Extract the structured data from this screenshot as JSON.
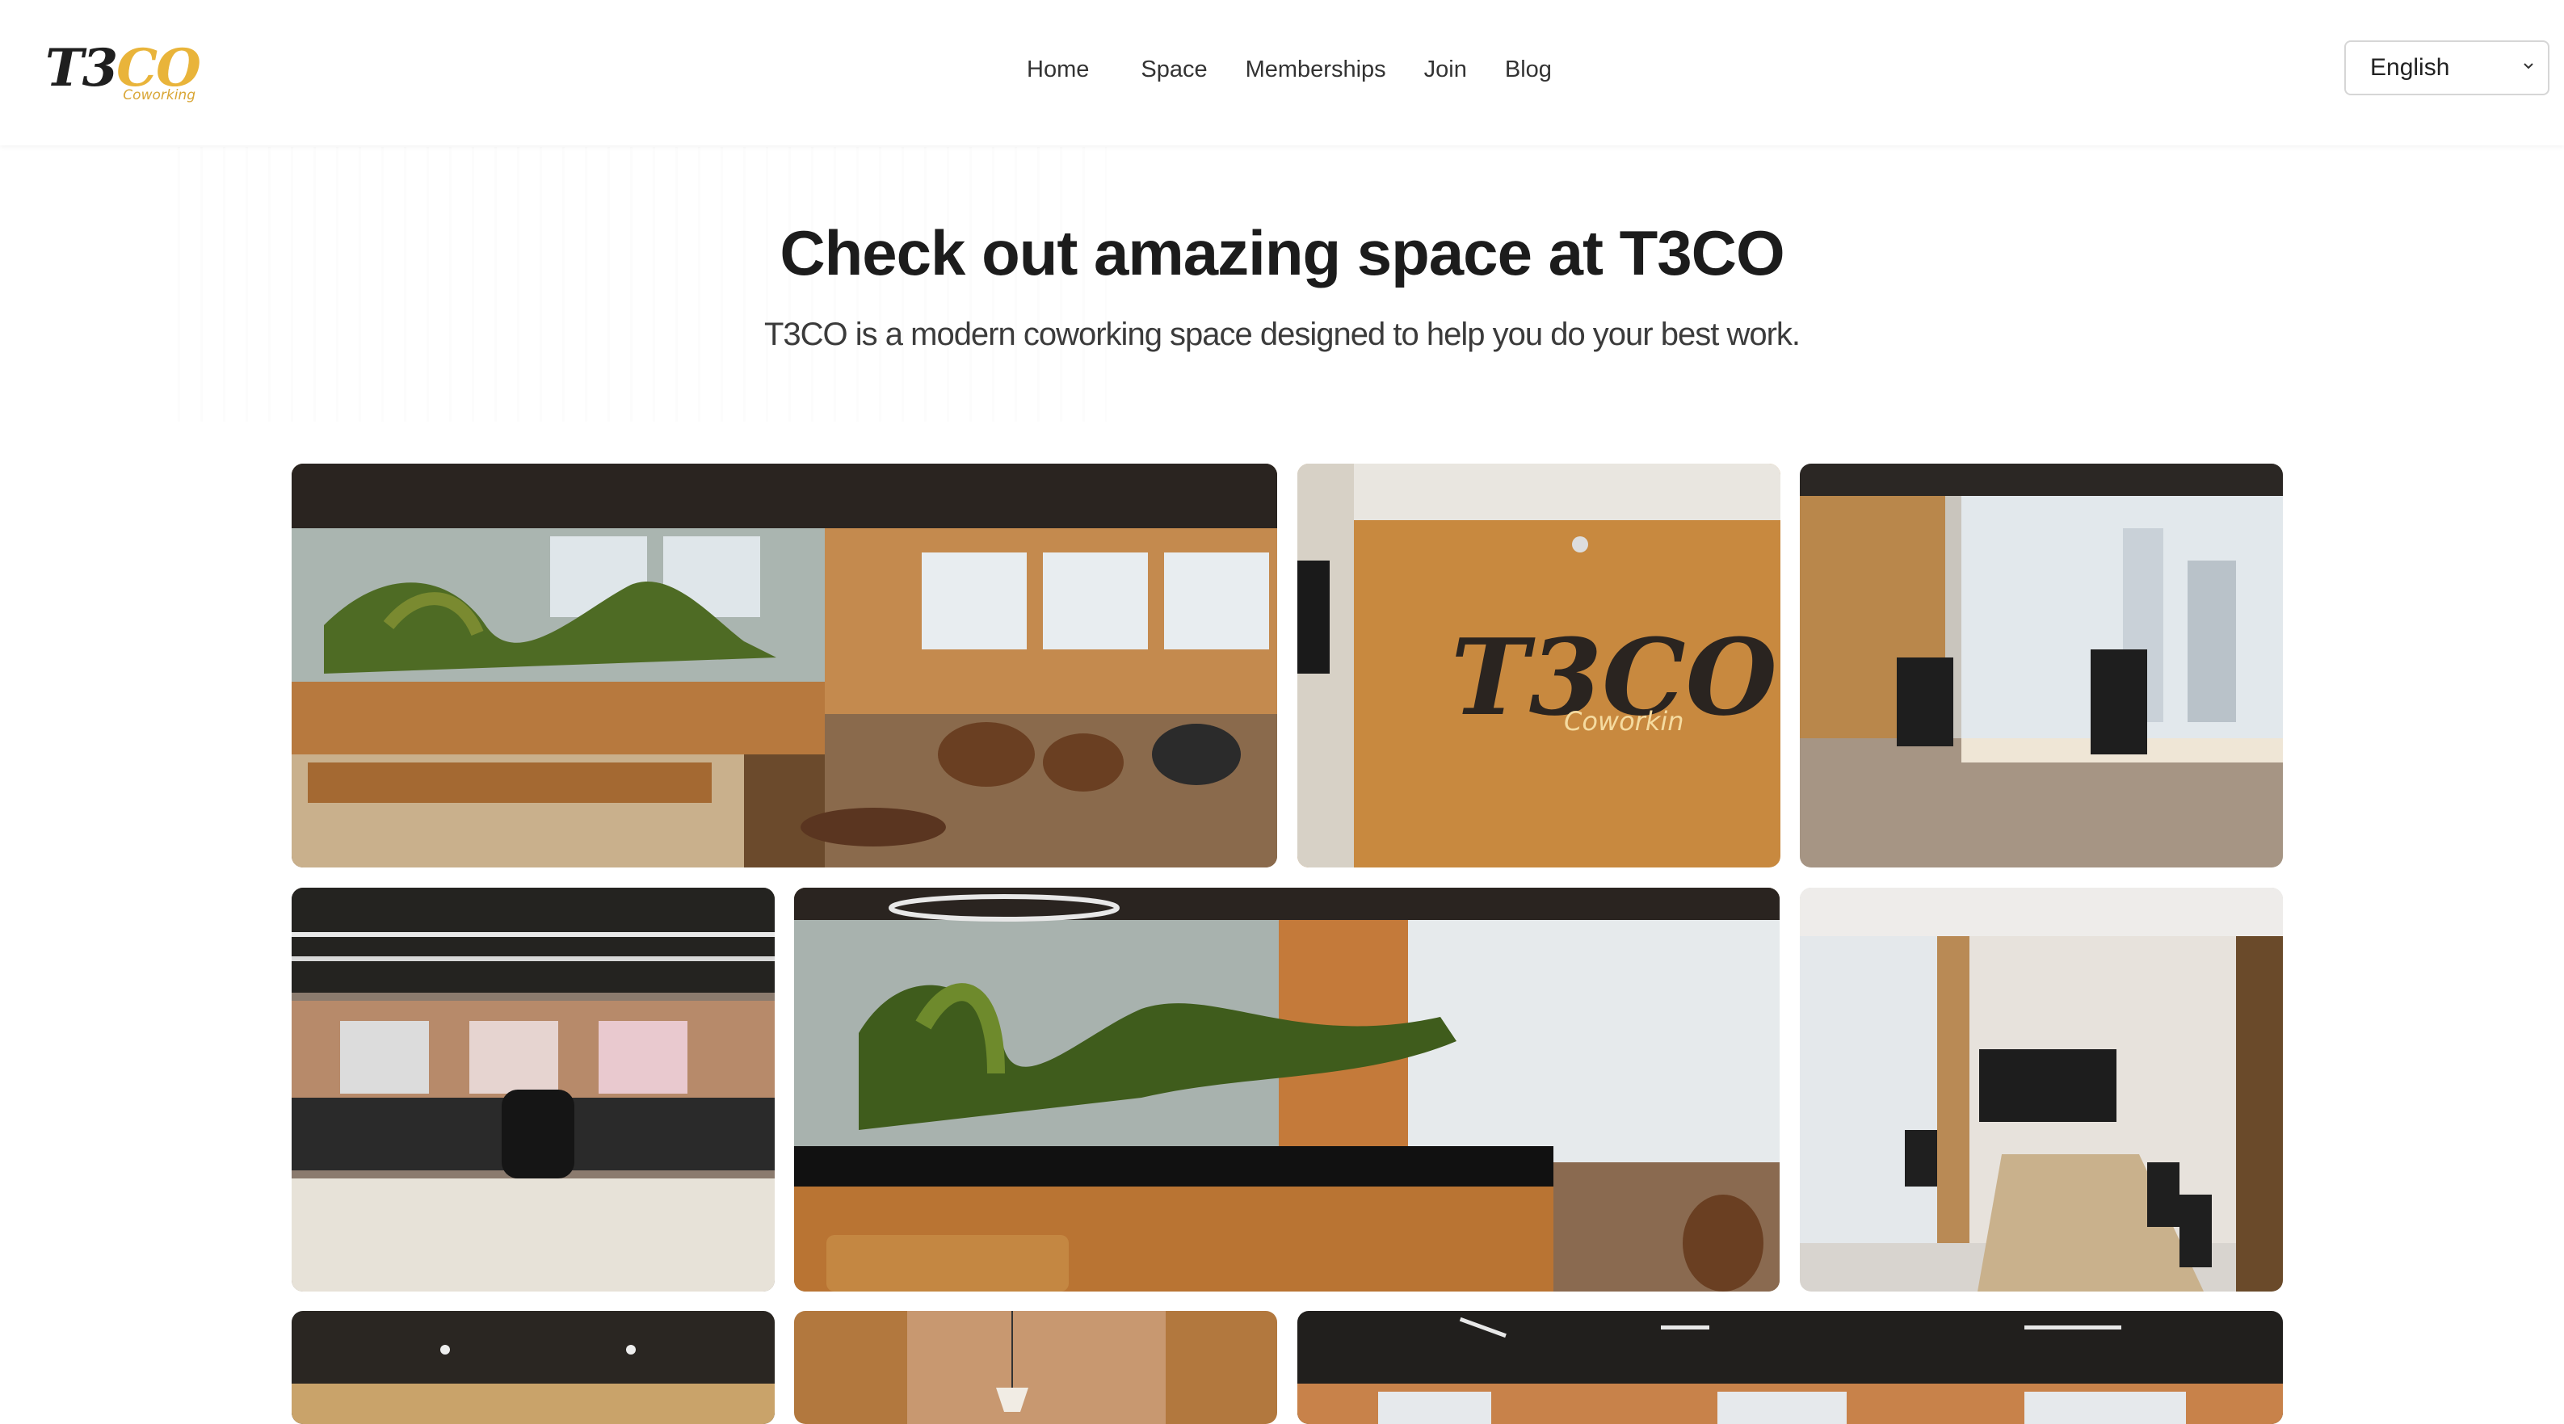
{
  "brand": {
    "logo_main": "T3CO",
    "logo_sub": "Coworking"
  },
  "nav": {
    "items": [
      {
        "label": "Home"
      },
      {
        "label": "Space"
      },
      {
        "label": "Memberships"
      },
      {
        "label": "Join"
      },
      {
        "label": "Blog"
      }
    ]
  },
  "language": {
    "selected": "English"
  },
  "hero": {
    "title": "Check out amazing space at T3CO",
    "subtitle": "T3CO is a modern coworking space designed to help you do your best work."
  },
  "gallery": {
    "images": [
      {
        "name": "lounge-aquarium-photo"
      },
      {
        "name": "logo-wall-photo",
        "wall_text": "T3CO",
        "wall_sub": "Coworkin"
      },
      {
        "name": "window-desks-photo"
      },
      {
        "name": "open-desk-area-photo"
      },
      {
        "name": "moss-aquarium-photo"
      },
      {
        "name": "meeting-room-photo"
      },
      {
        "name": "row3-left-photo"
      },
      {
        "name": "row3-middle-photo"
      },
      {
        "name": "row3-right-photo"
      }
    ]
  }
}
